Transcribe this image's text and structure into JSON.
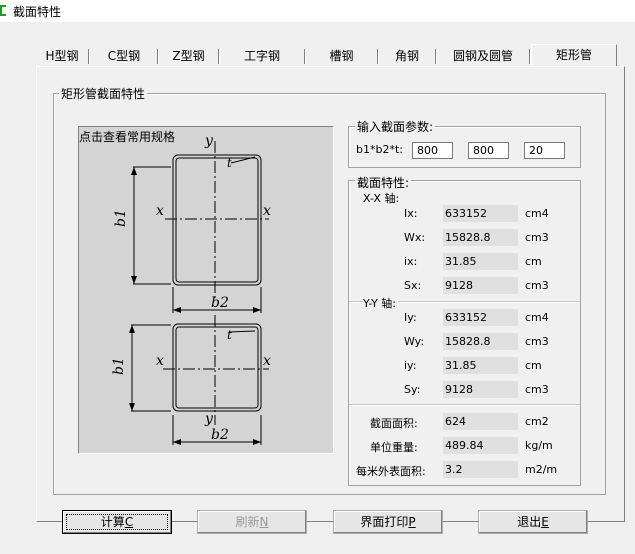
{
  "window": {
    "title": "截面特性"
  },
  "tabs": [
    {
      "label": "H型钢",
      "active": false
    },
    {
      "label": "C型钢",
      "active": false
    },
    {
      "label": "Z型钢",
      "active": false
    },
    {
      "label": "工字钢",
      "active": false
    },
    {
      "label": "槽钢",
      "active": false
    },
    {
      "label": "角钢",
      "active": false
    },
    {
      "label": "圆钢及圆管",
      "active": false
    },
    {
      "label": "矩形管",
      "active": true
    }
  ],
  "section_group": {
    "title": "矩形管截面特性"
  },
  "diagram": {
    "caption": "点击查看常用规格",
    "labels": {
      "y": "y",
      "x": "x",
      "t": "t",
      "b1": "b1",
      "b2": "b2"
    }
  },
  "input_group": {
    "title": "输入截面参数:",
    "label": "b1*b2*t:",
    "b1": "800",
    "b2": "800",
    "t": "20"
  },
  "props_group": {
    "title": "截面特性:",
    "xx_axis_label": "X-X 轴:",
    "yy_axis_label": "Y-Y 轴:",
    "xx": [
      {
        "name": "Ix:",
        "value": "633152",
        "unit": "cm4"
      },
      {
        "name": "Wx:",
        "value": "15828.8",
        "unit": "cm3"
      },
      {
        "name": "ix:",
        "value": "31.85",
        "unit": "cm"
      },
      {
        "name": "Sx:",
        "value": "9128",
        "unit": "cm3"
      }
    ],
    "yy": [
      {
        "name": "Iy:",
        "value": "633152",
        "unit": "cm4"
      },
      {
        "name": "Wy:",
        "value": "15828.8",
        "unit": "cm3"
      },
      {
        "name": "iy:",
        "value": "31.85",
        "unit": "cm"
      },
      {
        "name": "Sy:",
        "value": "9128",
        "unit": "cm3"
      }
    ],
    "general": [
      {
        "name": "截面面积:",
        "value": "624",
        "unit": "cm2"
      },
      {
        "name": "单位重量:",
        "value": "489.84",
        "unit": "kg/m"
      },
      {
        "name": "每米外表面积:",
        "value": "3.2",
        "unit": "m2/m"
      }
    ]
  },
  "buttons": {
    "calc": {
      "label": "计算",
      "key": "C"
    },
    "refresh": {
      "label": "刷新",
      "key": "N"
    },
    "print": {
      "label": "界面打印",
      "key": "P"
    },
    "exit": {
      "label": "退出",
      "key": "E"
    }
  }
}
